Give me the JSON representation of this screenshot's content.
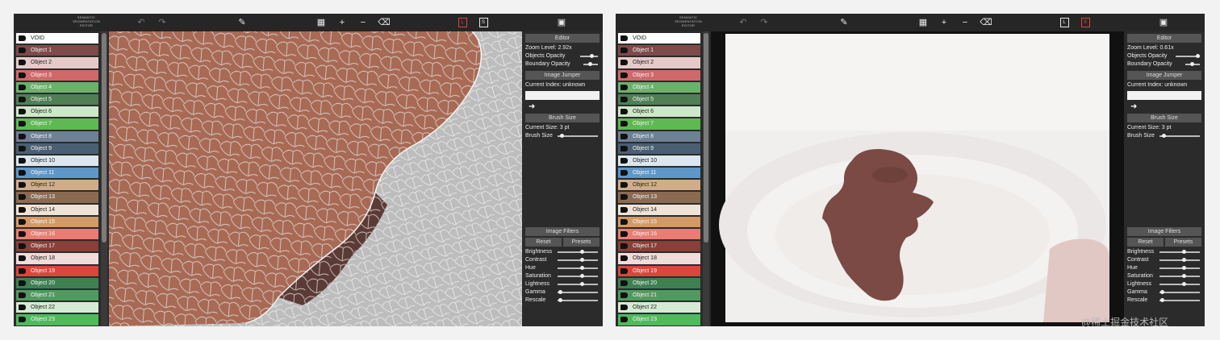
{
  "logo": {
    "line1": "SEMANTIC",
    "line2": "SEGMENTATION",
    "line3": "EDITOR"
  },
  "labels": [
    {
      "name": "VOID",
      "color": "#ffffff"
    },
    {
      "name": "Object 1",
      "color": "#7e4a4a"
    },
    {
      "name": "Object 2",
      "color": "#e8c9c9"
    },
    {
      "name": "Object 3",
      "color": "#cf6969"
    },
    {
      "name": "Object 4",
      "color": "#69b26b"
    },
    {
      "name": "Object 5",
      "color": "#4f7f53"
    },
    {
      "name": "Object 6",
      "color": "#cde7c9"
    },
    {
      "name": "Object 7",
      "color": "#5fb952"
    },
    {
      "name": "Object 8",
      "color": "#6e8094"
    },
    {
      "name": "Object 9",
      "color": "#4b5f73"
    },
    {
      "name": "Object 10",
      "color": "#dbe6ee"
    },
    {
      "name": "Object 11",
      "color": "#5e97c8"
    },
    {
      "name": "Object 12",
      "color": "#d0ad8a"
    },
    {
      "name": "Object 13",
      "color": "#8a6b52"
    },
    {
      "name": "Object 14",
      "color": "#efe3d7"
    },
    {
      "name": "Object 15",
      "color": "#d49a66"
    },
    {
      "name": "Object 16",
      "color": "#ea7c72"
    },
    {
      "name": "Object 17",
      "color": "#8a3f38"
    },
    {
      "name": "Object 18",
      "color": "#f0dcd9"
    },
    {
      "name": "Object 19",
      "color": "#d9463c"
    },
    {
      "name": "Object 20",
      "color": "#3f8052"
    },
    {
      "name": "Object 21",
      "color": "#4e9b5f"
    },
    {
      "name": "Object 22",
      "color": "#d5ebd3"
    },
    {
      "name": "Object 23",
      "color": "#4dbb5c"
    }
  ],
  "panels": [
    {
      "zoom": "Zoom Level: 2.92x",
      "mode_left": "L",
      "mode_right": "S"
    },
    {
      "zoom": "Zoom Level: 0.61x",
      "mode_left": "L",
      "mode_right": "S"
    }
  ],
  "sidebar": {
    "editor": "Editor",
    "objects_opacity": "Objects Opacity",
    "boundary_opacity": "Boundary Opacity",
    "image_jumper": "Image Jumper",
    "current_index": "Current Index: unknown",
    "brush_size_header": "Brush Size",
    "current_size": "Current Size: 3 pt",
    "brush_size": "Brush Size",
    "image_filters": "Image Filters",
    "reset": "Reset",
    "presets": "Presets",
    "filters": [
      "Brightness",
      "Contrast",
      "Hue",
      "Saturation",
      "Lightness",
      "Gamma",
      "Rescale"
    ]
  },
  "watermark": "@稀土掘金技术社区"
}
